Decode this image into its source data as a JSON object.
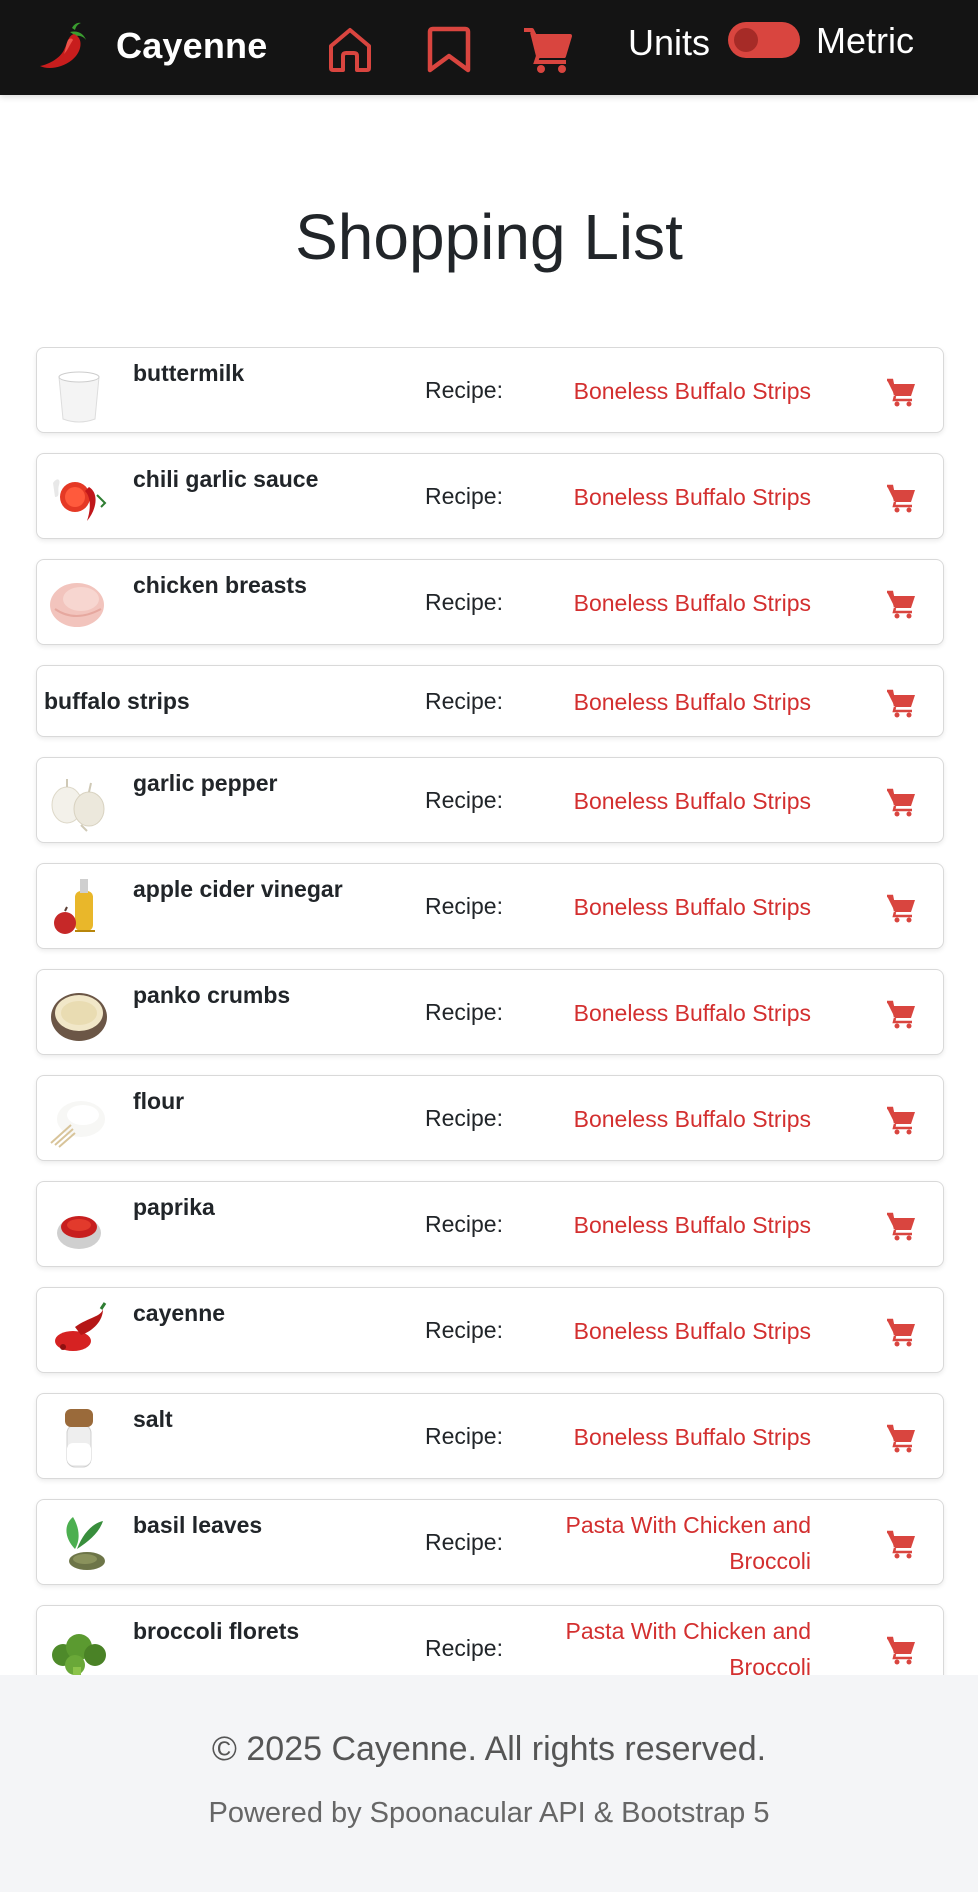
{
  "app": {
    "name": "Cayenne"
  },
  "nav": {
    "icons": [
      "home-icon",
      "bookmark-icon",
      "cart-icon"
    ],
    "units_label": "Units",
    "metric_label": "Metric",
    "metric_enabled": false
  },
  "colors": {
    "accent": "#d9453f",
    "link": "#d32f2f",
    "navbar": "#141414",
    "footer": "#f4f5f7"
  },
  "page": {
    "title": "Shopping List"
  },
  "items": [
    {
      "name": "buttermilk",
      "recipe_label": "Recipe:",
      "recipe": "Boneless Buffalo Strips",
      "image": "buttermilk"
    },
    {
      "name": "chili garlic sauce",
      "recipe_label": "Recipe:",
      "recipe": "Boneless Buffalo Strips",
      "image": "chili-sauce"
    },
    {
      "name": "chicken breasts",
      "recipe_label": "Recipe:",
      "recipe": "Boneless Buffalo Strips",
      "image": "chicken"
    },
    {
      "name": "buffalo strips",
      "recipe_label": "Recipe:",
      "recipe": "Boneless Buffalo Strips",
      "image": ""
    },
    {
      "name": "garlic pepper",
      "recipe_label": "Recipe:",
      "recipe": "Boneless Buffalo Strips",
      "image": "garlic"
    },
    {
      "name": "apple cider vinegar",
      "recipe_label": "Recipe:",
      "recipe": "Boneless Buffalo Strips",
      "image": "vinegar"
    },
    {
      "name": "panko crumbs",
      "recipe_label": "Recipe:",
      "recipe": "Boneless Buffalo Strips",
      "image": "panko"
    },
    {
      "name": "flour",
      "recipe_label": "Recipe:",
      "recipe": "Boneless Buffalo Strips",
      "image": "flour"
    },
    {
      "name": "paprika",
      "recipe_label": "Recipe:",
      "recipe": "Boneless Buffalo Strips",
      "image": "paprika"
    },
    {
      "name": "cayenne",
      "recipe_label": "Recipe:",
      "recipe": "Boneless Buffalo Strips",
      "image": "cayenne"
    },
    {
      "name": "salt",
      "recipe_label": "Recipe:",
      "recipe": "Boneless Buffalo Strips",
      "image": "salt"
    },
    {
      "name": "basil leaves",
      "recipe_label": "Recipe:",
      "recipe": "Pasta With Chicken and Broccoli",
      "image": "basil"
    },
    {
      "name": "broccoli florets",
      "recipe_label": "Recipe:",
      "recipe": "Pasta With Chicken and Broccoli",
      "image": "broccoli"
    }
  ],
  "footer": {
    "copyright": "© 2025 Cayenne. All rights reserved.",
    "powered": "Powered by Spoonacular API & Bootstrap 5"
  }
}
